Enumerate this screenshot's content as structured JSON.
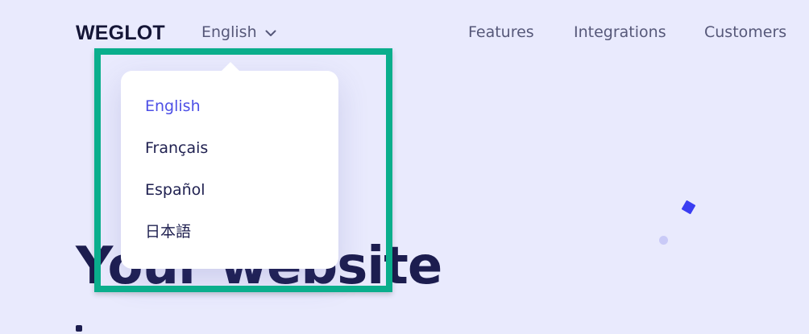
{
  "header": {
    "logo_text": "WEGLOT",
    "language_selector": {
      "current": "English"
    },
    "nav": [
      {
        "label": "Features"
      },
      {
        "label": "Integrations"
      },
      {
        "label": "Customers"
      }
    ]
  },
  "dropdown": {
    "items": [
      {
        "label": "English",
        "active": true
      },
      {
        "label": "Français",
        "active": false
      },
      {
        "label": "Español",
        "active": false
      },
      {
        "label": "日本語",
        "active": false
      }
    ]
  },
  "hero": {
    "title": "Your website"
  },
  "colors": {
    "background": "#e9eafd",
    "accent": "#4d4fe6",
    "highlight": "#0aae8c",
    "text_dark": "#1c1d4f"
  }
}
